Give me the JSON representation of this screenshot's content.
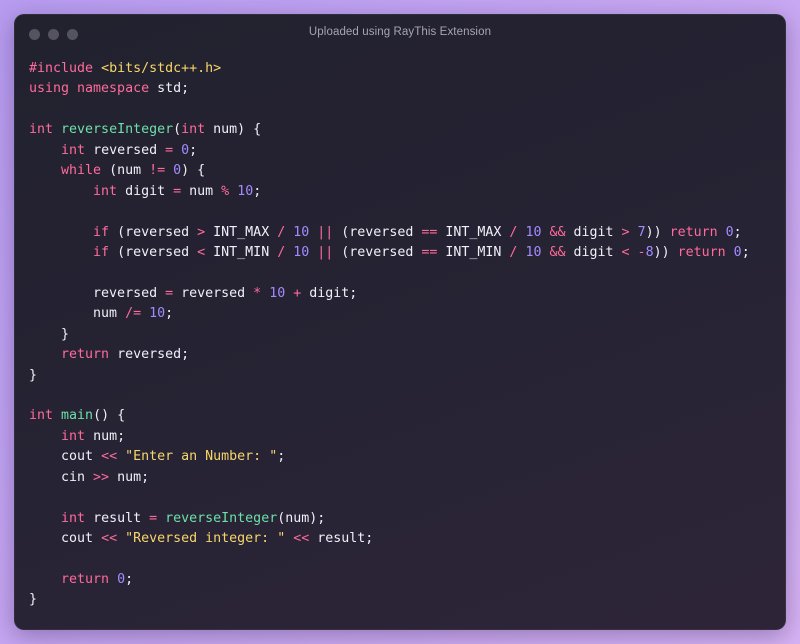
{
  "window": {
    "title": "Uploaded using RayThis Extension",
    "controls": [
      "close-dot",
      "minimize-dot",
      "zoom-dot"
    ]
  },
  "code": {
    "language": "cpp",
    "lines": [
      [
        [
          "pp",
          "#include "
        ],
        [
          "inc",
          "<bits/stdc++.h>"
        ]
      ],
      [
        [
          "kw",
          "using namespace "
        ],
        [
          "tx",
          "std;"
        ]
      ],
      [],
      [
        [
          "kw",
          "int "
        ],
        [
          "fn",
          "reverseInteger"
        ],
        [
          "tx",
          "("
        ],
        [
          "kw",
          "int "
        ],
        [
          "tx",
          "num) {"
        ]
      ],
      [
        [
          "tx",
          "    "
        ],
        [
          "kw",
          "int "
        ],
        [
          "tx",
          "reversed "
        ],
        [
          "op",
          "= "
        ],
        [
          "num",
          "0"
        ],
        [
          "tx",
          ";"
        ]
      ],
      [
        [
          "tx",
          "    "
        ],
        [
          "kw",
          "while "
        ],
        [
          "tx",
          "(num "
        ],
        [
          "op",
          "!= "
        ],
        [
          "num",
          "0"
        ],
        [
          "tx",
          ") {"
        ]
      ],
      [
        [
          "tx",
          "        "
        ],
        [
          "kw",
          "int "
        ],
        [
          "tx",
          "digit "
        ],
        [
          "op",
          "= "
        ],
        [
          "tx",
          "num "
        ],
        [
          "op",
          "% "
        ],
        [
          "num",
          "10"
        ],
        [
          "tx",
          ";"
        ]
      ],
      [],
      [
        [
          "tx",
          "        "
        ],
        [
          "kw",
          "if "
        ],
        [
          "tx",
          "(reversed "
        ],
        [
          "op",
          "> "
        ],
        [
          "tx",
          "INT_MAX "
        ],
        [
          "op",
          "/ "
        ],
        [
          "num",
          "10 "
        ],
        [
          "op",
          "|| "
        ],
        [
          "tx",
          "(reversed "
        ],
        [
          "op",
          "== "
        ],
        [
          "tx",
          "INT_MAX "
        ],
        [
          "op",
          "/ "
        ],
        [
          "num",
          "10 "
        ],
        [
          "op",
          "&& "
        ],
        [
          "tx",
          "digit "
        ],
        [
          "op",
          "> "
        ],
        [
          "num",
          "7"
        ],
        [
          "tx",
          ")) "
        ],
        [
          "kw",
          "return "
        ],
        [
          "num",
          "0"
        ],
        [
          "tx",
          ";"
        ]
      ],
      [
        [
          "tx",
          "        "
        ],
        [
          "kw",
          "if "
        ],
        [
          "tx",
          "(reversed "
        ],
        [
          "op",
          "< "
        ],
        [
          "tx",
          "INT_MIN "
        ],
        [
          "op",
          "/ "
        ],
        [
          "num",
          "10 "
        ],
        [
          "op",
          "|| "
        ],
        [
          "tx",
          "(reversed "
        ],
        [
          "op",
          "== "
        ],
        [
          "tx",
          "INT_MIN "
        ],
        [
          "op",
          "/ "
        ],
        [
          "num",
          "10 "
        ],
        [
          "op",
          "&& "
        ],
        [
          "tx",
          "digit "
        ],
        [
          "op",
          "< -"
        ],
        [
          "num",
          "8"
        ],
        [
          "tx",
          ")) "
        ],
        [
          "kw",
          "return "
        ],
        [
          "num",
          "0"
        ],
        [
          "tx",
          ";"
        ]
      ],
      [],
      [
        [
          "tx",
          "        reversed "
        ],
        [
          "op",
          "= "
        ],
        [
          "tx",
          "reversed "
        ],
        [
          "op",
          "* "
        ],
        [
          "num",
          "10 "
        ],
        [
          "op",
          "+ "
        ],
        [
          "tx",
          "digit;"
        ]
      ],
      [
        [
          "tx",
          "        num "
        ],
        [
          "op",
          "/= "
        ],
        [
          "num",
          "10"
        ],
        [
          "tx",
          ";"
        ]
      ],
      [
        [
          "tx",
          "    }"
        ]
      ],
      [
        [
          "tx",
          "    "
        ],
        [
          "kw",
          "return "
        ],
        [
          "tx",
          "reversed;"
        ]
      ],
      [
        [
          "tx",
          "}"
        ]
      ],
      [],
      [
        [
          "kw",
          "int "
        ],
        [
          "fn",
          "main"
        ],
        [
          "tx",
          "() {"
        ]
      ],
      [
        [
          "tx",
          "    "
        ],
        [
          "kw",
          "int "
        ],
        [
          "tx",
          "num;"
        ]
      ],
      [
        [
          "tx",
          "    cout "
        ],
        [
          "op",
          "<< "
        ],
        [
          "str",
          "\"Enter an Number: \""
        ],
        [
          "tx",
          ";"
        ]
      ],
      [
        [
          "tx",
          "    cin "
        ],
        [
          "op",
          ">> "
        ],
        [
          "tx",
          "num;"
        ]
      ],
      [],
      [
        [
          "tx",
          "    "
        ],
        [
          "kw",
          "int "
        ],
        [
          "tx",
          "result "
        ],
        [
          "op",
          "= "
        ],
        [
          "fn",
          "reverseInteger"
        ],
        [
          "tx",
          "(num);"
        ]
      ],
      [
        [
          "tx",
          "    cout "
        ],
        [
          "op",
          "<< "
        ],
        [
          "str",
          "\"Reversed integer: \" "
        ],
        [
          "op",
          "<< "
        ],
        [
          "tx",
          "result;"
        ]
      ],
      [],
      [
        [
          "tx",
          "    "
        ],
        [
          "kw",
          "return "
        ],
        [
          "num",
          "0"
        ],
        [
          "tx",
          ";"
        ]
      ],
      [
        [
          "tx",
          "}"
        ]
      ]
    ]
  },
  "colors": {
    "background": "#c3a6f2",
    "window": "#252331",
    "keyword": "#ff6b9b",
    "string": "#f6d66a",
    "function": "#6ee0a8",
    "number": "#a38bff",
    "text": "#f1eff7"
  }
}
